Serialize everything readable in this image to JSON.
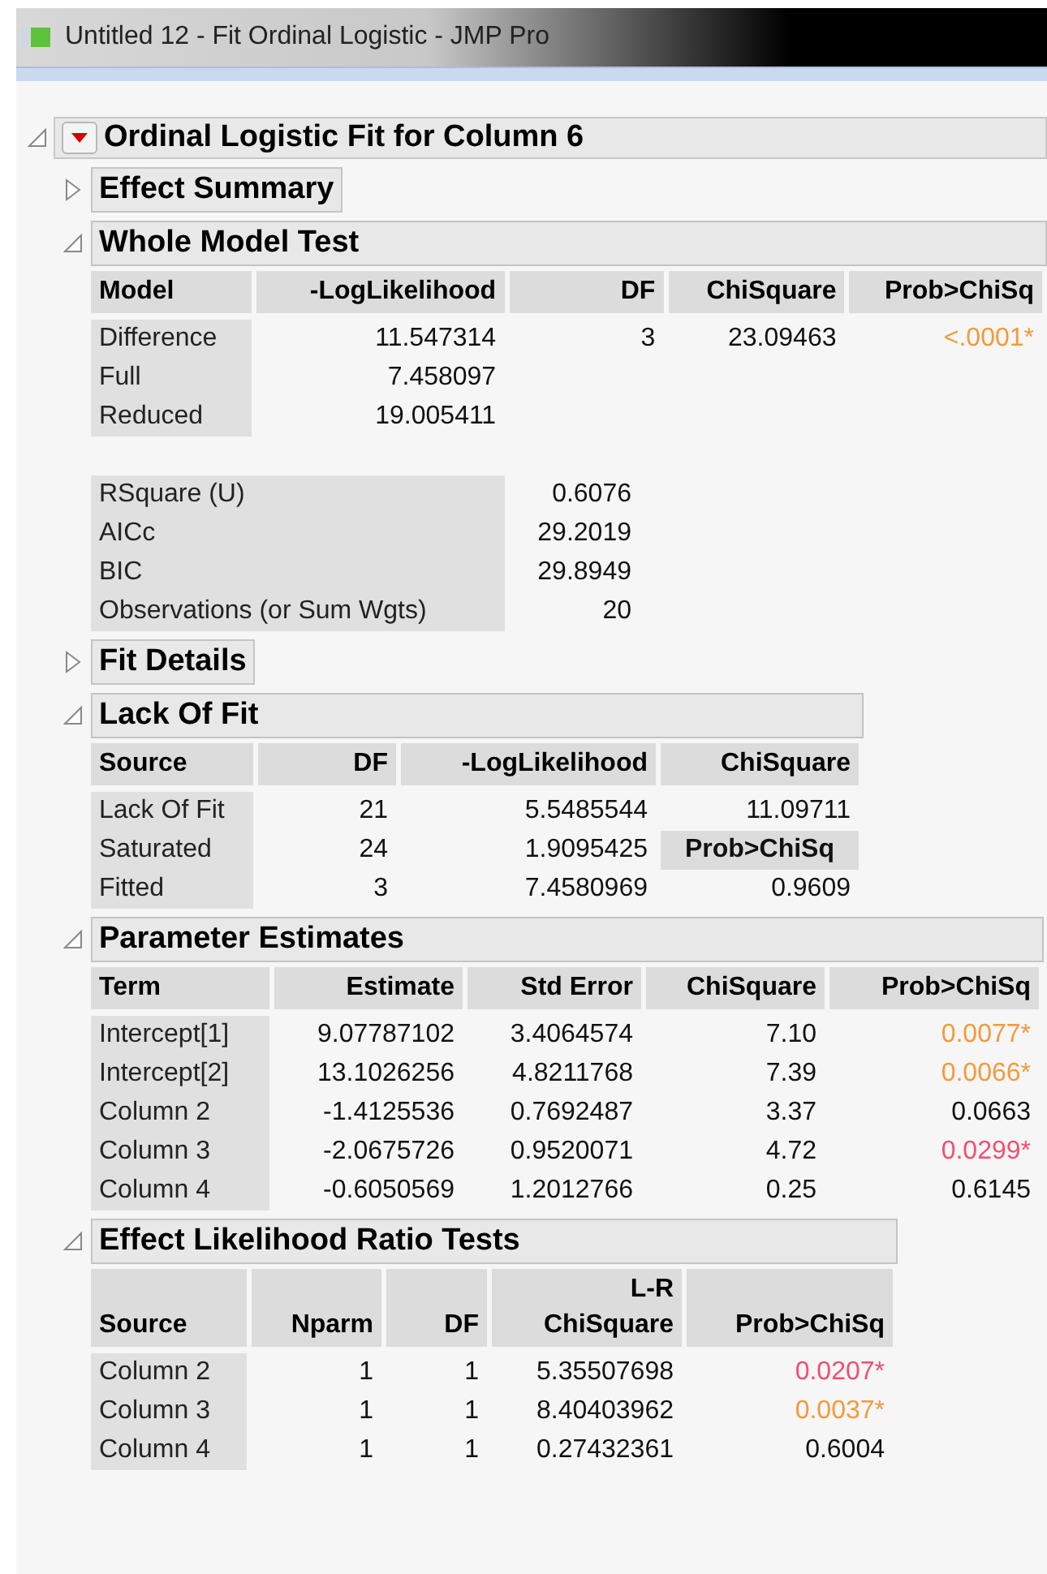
{
  "window": {
    "title": "Untitled 12 - Fit Ordinal Logistic - JMP Pro"
  },
  "report": {
    "title": "Ordinal Logistic Fit for Column 6",
    "expanded": true,
    "sections": [
      {
        "title": "Effect Summary",
        "expanded": false
      },
      {
        "title": "Whole Model Test",
        "expanded": true,
        "tables": [
          {
            "columns": [
              {
                "label": "Model"
              },
              {
                "label": "-LogLikelihood"
              },
              {
                "label": "DF"
              },
              {
                "label": "ChiSquare"
              },
              {
                "label": "Prob>ChiSq"
              }
            ],
            "rows": [
              [
                "Difference",
                "11.547314",
                "3",
                "23.09463",
                {
                  "text": "<.0001*",
                  "color": "#f39a3c"
                }
              ],
              [
                "Full",
                "7.458097"
              ],
              [
                "Reduced",
                "19.005411"
              ]
            ]
          },
          {
            "rows": [
              [
                "RSquare (U)",
                "0.6076"
              ],
              [
                "AICc",
                "29.2019"
              ],
              [
                "BIC",
                "29.8949"
              ],
              [
                "Observations (or Sum Wgts)",
                "20"
              ]
            ]
          }
        ]
      },
      {
        "title": "Fit Details",
        "expanded": false
      },
      {
        "title": "Lack Of Fit",
        "expanded": true,
        "tables": [
          {
            "columns": [
              {
                "label": "Source"
              },
              {
                "label": "DF"
              },
              {
                "label": "-LogLikelihood"
              },
              {
                "label": "ChiSquare"
              }
            ],
            "rows": [
              [
                "Lack Of Fit",
                "21",
                "5.5485544",
                "11.09711"
              ],
              [
                "Saturated",
                "24",
                "1.9095425",
                {
                  "text": "Prob>ChiSq",
                  "kind": "header"
                }
              ],
              [
                "Fitted",
                "3",
                "7.4580969",
                "0.9609"
              ]
            ]
          }
        ]
      },
      {
        "title": "Parameter Estimates",
        "expanded": true,
        "tables": [
          {
            "columns": [
              {
                "label": "Term"
              },
              {
                "label": "Estimate"
              },
              {
                "label": "Std Error"
              },
              {
                "label": "ChiSquare"
              },
              {
                "label": "Prob>ChiSq"
              }
            ],
            "rows": [
              [
                "Intercept[1]",
                "9.07787102",
                "3.4064574",
                "7.10",
                {
                  "text": "0.0077*",
                  "color": "#f39a3c"
                }
              ],
              [
                "Intercept[2]",
                "13.1026256",
                "4.8211768",
                "7.39",
                {
                  "text": "0.0066*",
                  "color": "#f39a3c"
                }
              ],
              [
                "Column 2",
                "-1.4125536",
                "0.7692487",
                "3.37",
                "0.0663"
              ],
              [
                "Column 3",
                "-2.0675726",
                "0.9520071",
                "4.72",
                {
                  "text": "0.0299*",
                  "color": "#f0506e"
                }
              ],
              [
                "Column 4",
                "-0.6050569",
                "1.2012766",
                "0.25",
                "0.6145"
              ]
            ]
          }
        ]
      },
      {
        "title": "Effect Likelihood Ratio Tests",
        "expanded": true,
        "tables": [
          {
            "columns": [
              {
                "label": "Source"
              },
              {
                "label": "Nparm"
              },
              {
                "label": "DF"
              },
              {
                "label": "ChiSquare",
                "top": "L-R"
              },
              {
                "label": "Prob>ChiSq"
              }
            ],
            "rows": [
              [
                "Column 2",
                "1",
                "1",
                "5.35507698",
                {
                  "text": "0.0207*",
                  "color": "#f0506e"
                }
              ],
              [
                "Column 3",
                "1",
                "1",
                "8.40403962",
                {
                  "text": "0.0037*",
                  "color": "#f39a3c"
                }
              ],
              [
                "Column 4",
                "1",
                "1",
                "0.27432361",
                "0.6004"
              ]
            ]
          }
        ]
      }
    ]
  }
}
